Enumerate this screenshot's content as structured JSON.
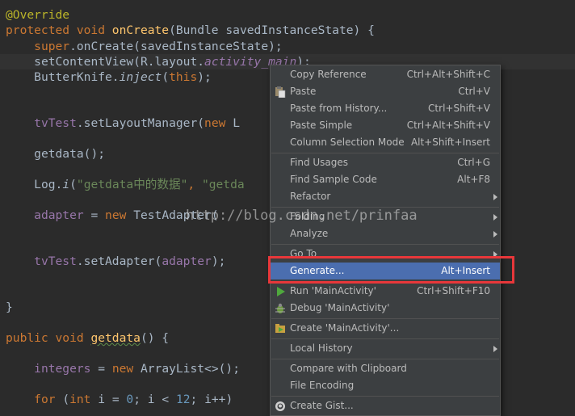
{
  "code": {
    "l1": "@Override",
    "l2_kw": "protected void ",
    "l2_fn": "onCreate",
    "l2_rest": "(Bundle savedInstanceState) {",
    "l3_kw": "super",
    "l3_rest": ".onCreate(savedInstanceState);",
    "l4_a": "setContentView(R.layout.",
    "l4_b": "activity_main",
    "l4_c": ");",
    "l5_a": "ButterKnife.",
    "l5_b": "inject",
    "l5_c": "(",
    "l5_d": "this",
    "l5_e": ");",
    "l6_a": "tvTest",
    "l6_b": ".setLayoutManager(",
    "l6_c": "new ",
    "l6_d": "L",
    "l7": "getdata();",
    "l8_a": "Log.",
    "l8_b": "i",
    "l8_c": "(",
    "l8_d": "\"getdata中的数据\"",
    "l8_e": ", ",
    "l8_f": "\"getda",
    "l9_a": "adapter",
    "l9_b": " = ",
    "l9_c": "new ",
    "l9_d": "TestAdapter(",
    "l10_a": "tvTest",
    "l10_b": ".setAdapter(",
    "l10_c": "adapter",
    "l10_d": ");",
    "l11": "}",
    "l12_a": "public void ",
    "l12_b": "getdata",
    "l12_c": "() {",
    "l13_a": "integers",
    "l13_b": " = ",
    "l13_c": "new ",
    "l13_d": "ArrayList<>();",
    "l14_a": "for ",
    "l14_b": "(",
    "l14_c": "int ",
    "l14_d": "i = ",
    "l14_e": "0",
    "l14_f": "; i < ",
    "l14_g": "12",
    "l14_h": "; i++)"
  },
  "watermark": "http://blog.csdn.net/prinfaa",
  "menu": {
    "items": [
      {
        "label": "Copy Reference",
        "shortcut": "Ctrl+Alt+Shift+C"
      },
      {
        "label": "Paste",
        "shortcut": "Ctrl+V"
      },
      {
        "label": "Paste from History...",
        "shortcut": "Ctrl+Shift+V"
      },
      {
        "label": "Paste Simple",
        "shortcut": "Ctrl+Alt+Shift+V"
      },
      {
        "label": "Column Selection Mode",
        "shortcut": "Alt+Shift+Insert"
      },
      {
        "label": "Find Usages",
        "shortcut": "Ctrl+G"
      },
      {
        "label": "Find Sample Code",
        "shortcut": "Alt+F8"
      },
      {
        "label": "Refactor",
        "shortcut": ""
      },
      {
        "label": "Folding",
        "shortcut": ""
      },
      {
        "label": "Analyze",
        "shortcut": ""
      },
      {
        "label": "Go To",
        "shortcut": ""
      },
      {
        "label": "Generate...",
        "shortcut": "Alt+Insert"
      },
      {
        "label": "Run 'MainActivity'",
        "shortcut": "Ctrl+Shift+F10"
      },
      {
        "label": "Debug 'MainActivity'",
        "shortcut": ""
      },
      {
        "label": "Create 'MainActivity'...",
        "shortcut": ""
      },
      {
        "label": "Local History",
        "shortcut": ""
      },
      {
        "label": "Compare with Clipboard",
        "shortcut": ""
      },
      {
        "label": "File Encoding",
        "shortcut": ""
      },
      {
        "label": "Create Gist...",
        "shortcut": ""
      }
    ],
    "icons": {
      "paste": "paste-icon",
      "run": "run-icon",
      "debug": "debug-icon",
      "create": "activity-icon",
      "gist": "github-icon"
    },
    "selected_color": "#4b6eaf",
    "highlight_box_color": "#e8373a"
  }
}
